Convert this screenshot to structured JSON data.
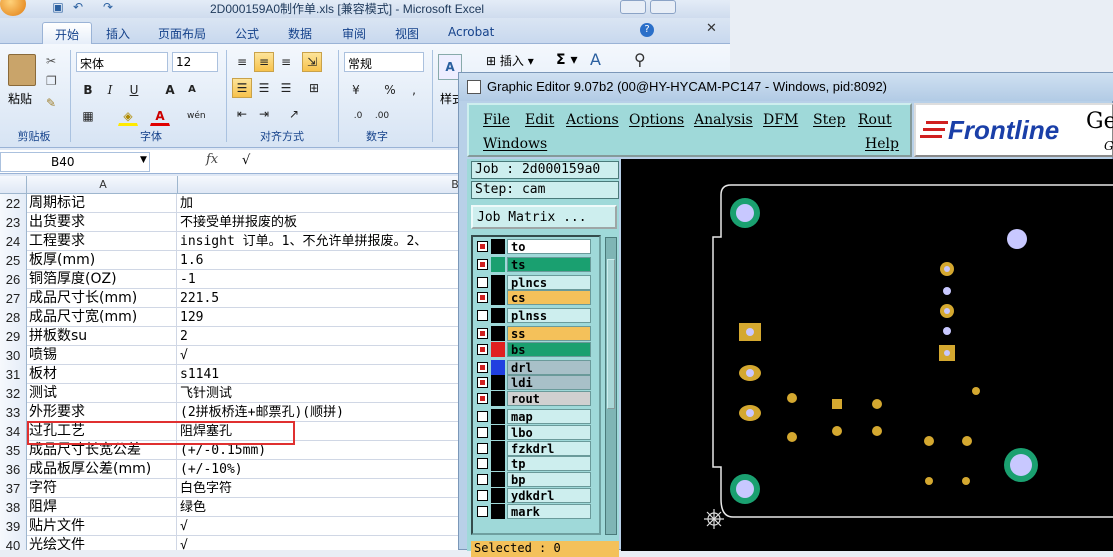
{
  "excel": {
    "title": "2D000159A0制作单.xls  [兼容模式] - Microsoft Excel",
    "tabs": [
      "开始",
      "插入",
      "页面布局",
      "公式",
      "数据",
      "审阅",
      "视图",
      "Acrobat"
    ],
    "ribbon": {
      "paste_label": "粘贴",
      "clipboard_label": "剪贴板",
      "font_name": "宋体",
      "font_size": "12",
      "font_group_label": "字体",
      "align_group_label": "对齐方式",
      "number_format": "常规",
      "number_group_label": "数字",
      "insert_label": "插入",
      "style_label": "样式"
    },
    "name_box": "B40",
    "fx_label": "fx",
    "formula_value": "√",
    "col_a": "A",
    "col_b": "B",
    "rows": [
      {
        "n": "22",
        "a": "周期标记",
        "b": "加"
      },
      {
        "n": "23",
        "a": "出货要求",
        "b": "不接受单拼报废的板"
      },
      {
        "n": "24",
        "a": "工程要求",
        "b": "insight 订单。1、不允许单拼报废。2、"
      },
      {
        "n": "25",
        "a": "板厚(mm)",
        "b": "1.6"
      },
      {
        "n": "26",
        "a": "铜箔厚度(OZ)",
        "b": "-1"
      },
      {
        "n": "27",
        "a": "成品尺寸长(mm)",
        "b": "221.5"
      },
      {
        "n": "28",
        "a": "成品尺寸宽(mm)",
        "b": "129"
      },
      {
        "n": "29",
        "a": "拼板数su",
        "b": "2"
      },
      {
        "n": "30",
        "a": "喷锡",
        "b": "√"
      },
      {
        "n": "31",
        "a": "板材",
        "b": "s1141"
      },
      {
        "n": "32",
        "a": "测试",
        "b": "飞针测试"
      },
      {
        "n": "33",
        "a": "外形要求",
        "b": "(2拼板桥连+邮票孔)(顺拼)"
      },
      {
        "n": "34",
        "a": "过孔工艺",
        "b": "阻焊塞孔"
      },
      {
        "n": "35",
        "a": "成品尺寸长宽公差",
        "b": "(+/-0.15mm)"
      },
      {
        "n": "36",
        "a": "成品板厚公差(mm)",
        "b": "(+/-10%)"
      },
      {
        "n": "37",
        "a": "字符",
        "b": "白色字符"
      },
      {
        "n": "38",
        "a": "阻焊",
        "b": "绿色"
      },
      {
        "n": "39",
        "a": "贴片文件",
        "b": "√"
      },
      {
        "n": "40",
        "a": "光绘文件",
        "b": "√"
      }
    ]
  },
  "editor": {
    "title": "Graphic Editor 9.07b2 (00@HY-HYCAM-PC147 - Windows, pid:8092)",
    "menu": [
      "File",
      "Edit",
      "Actions",
      "Options",
      "Analysis",
      "DFM",
      "Step",
      "Rout"
    ],
    "menu2": [
      "Windows",
      "Help"
    ],
    "logo": "Frontline",
    "logo_g": "Ge",
    "logo_g2": "G",
    "job": "Job : 2d000159a0",
    "step": "Step: cam",
    "job_matrix": "Job Matrix ...",
    "selected": "Selected : 0",
    "layers": [
      {
        "name": "to",
        "color": "#ffffff",
        "on": true,
        "swatch": "#000000"
      },
      {
        "name": "ts",
        "color": "#1aa070",
        "on": true,
        "swatch": "#1aa070"
      },
      {
        "name": "plncs",
        "color": "#cdeeee",
        "on": false,
        "swatch": "#000000"
      },
      {
        "name": "cs",
        "color": "#f4c15a",
        "on": true,
        "swatch": "#000000"
      },
      {
        "name": "plnss",
        "color": "#cdeeee",
        "on": false,
        "swatch": "#000000"
      },
      {
        "name": "ss",
        "color": "#f4c15a",
        "on": true,
        "swatch": "#000000"
      },
      {
        "name": "bs",
        "color": "#1aa070",
        "on": true,
        "swatch": "#e02020"
      },
      {
        "name": "drl",
        "color": "#a8c0c8",
        "on": true,
        "swatch": "#2040e0"
      },
      {
        "name": "ldi",
        "color": "#a8c0c8",
        "on": true,
        "swatch": "#000000"
      },
      {
        "name": "rout",
        "color": "#d0d0d0",
        "on": true,
        "swatch": "#000000"
      },
      {
        "name": "map",
        "color": "#cdeeee",
        "on": false,
        "swatch": "#000000"
      },
      {
        "name": "lbo",
        "color": "#cdeeee",
        "on": false,
        "swatch": "#000000"
      },
      {
        "name": "fzkdrl",
        "color": "#cdeeee",
        "on": false,
        "swatch": "#000000"
      },
      {
        "name": "tp",
        "color": "#cdeeee",
        "on": false,
        "swatch": "#000000"
      },
      {
        "name": "bp",
        "color": "#cdeeee",
        "on": false,
        "swatch": "#000000"
      },
      {
        "name": "ydkdrl",
        "color": "#cdeeee",
        "on": false,
        "swatch": "#000000"
      },
      {
        "name": "mark",
        "color": "#cdeeee",
        "on": false,
        "swatch": "#000000"
      }
    ]
  }
}
